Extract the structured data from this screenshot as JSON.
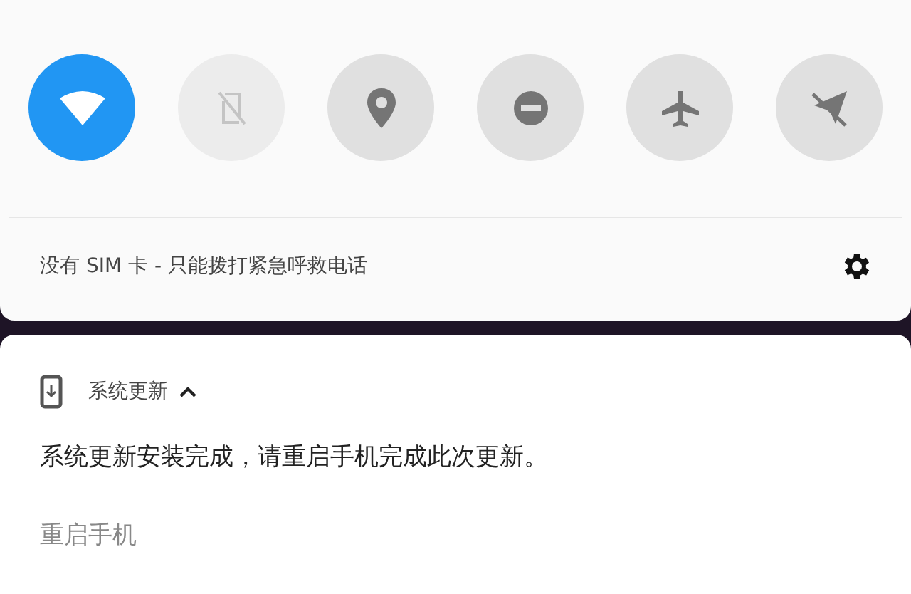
{
  "quick_settings": {
    "tiles": [
      {
        "kind": "wifi",
        "on": true,
        "disabled": false
      },
      {
        "kind": "sim",
        "on": false,
        "disabled": true
      },
      {
        "kind": "location",
        "on": false,
        "disabled": false
      },
      {
        "kind": "dnd",
        "on": false,
        "disabled": false
      },
      {
        "kind": "airplane",
        "on": false,
        "disabled": false
      },
      {
        "kind": "airplane-off",
        "on": false,
        "disabled": false
      }
    ],
    "status_text": "没有 SIM 卡 - 只能拨打紧急呼救电话"
  },
  "notification": {
    "app_name": "系统更新",
    "expanded": true,
    "message": "系统更新安装完成，请重启手机完成此次更新。",
    "action": "重启手机"
  }
}
